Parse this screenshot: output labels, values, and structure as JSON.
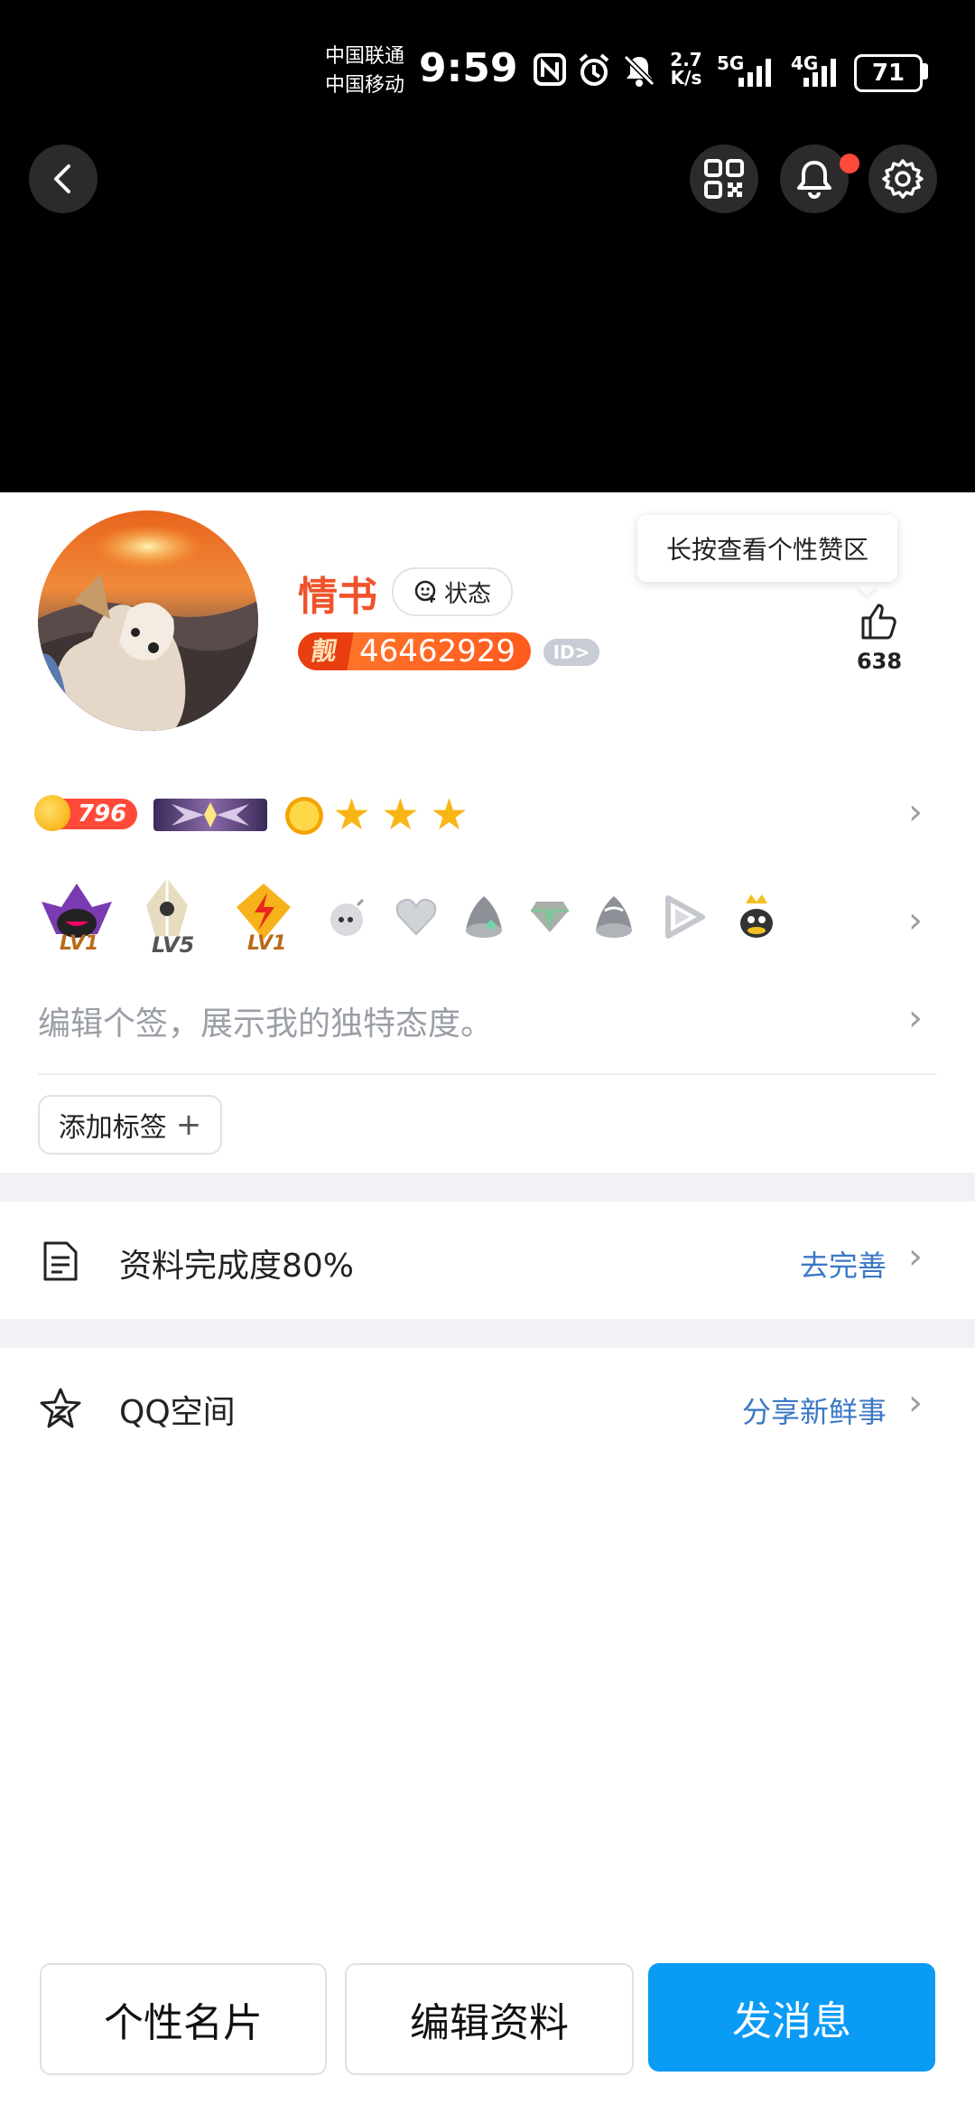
{
  "status_bar": {
    "carrier1": "中国联通",
    "carrier2": "中国移动",
    "time": "9:59",
    "speed_value": "2.7",
    "speed_unit": "K/s",
    "net1": "5G",
    "net2": "4G",
    "battery": "71"
  },
  "profile": {
    "nickname": "情书",
    "status_label": "状态",
    "liang_label": "靓",
    "qq_number": "46462929",
    "id_chip": "ID>",
    "tooltip": "长按查看个性赞区",
    "like_count": "638",
    "level_value": "796",
    "medals": [
      {
        "name": "badge-lv1-purple",
        "label": "LV1"
      },
      {
        "name": "badge-lv5-crystal",
        "label": "LV5"
      },
      {
        "name": "badge-lv1-lightning",
        "label": "LV1"
      },
      {
        "name": "bomb-icon",
        "label": ""
      },
      {
        "name": "heart-icon",
        "label": ""
      },
      {
        "name": "penguin-gray-icon",
        "label": ""
      },
      {
        "name": "diamond-icon",
        "label": ""
      },
      {
        "name": "penguin-gray-icon-2",
        "label": ""
      },
      {
        "name": "play-icon",
        "label": ""
      },
      {
        "name": "crown-penguin-icon",
        "label": ""
      }
    ],
    "signature_placeholder": "编辑个签，展示我的独特态度。",
    "add_tag_label": "添加标签",
    "add_tag_plus": "+"
  },
  "rows": {
    "completeness_label": "资料完成度80%",
    "completeness_link": "去完善",
    "qzone_label": "QQ空间",
    "qzone_link": "分享新鲜事"
  },
  "buttons": {
    "card": "个性名片",
    "edit": "编辑资料",
    "message": "发消息"
  },
  "colors": {
    "accent": "#0a9bf5",
    "nickname": "#f0532b",
    "link": "#3b78c4"
  }
}
